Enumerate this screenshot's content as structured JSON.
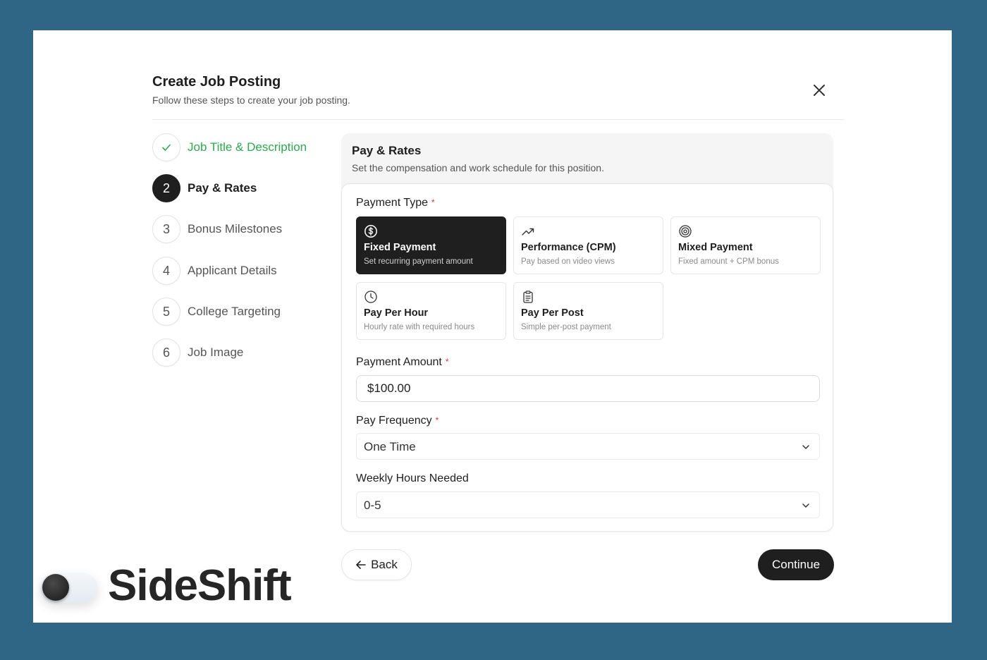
{
  "dialog": {
    "title": "Create Job Posting",
    "subtitle": "Follow these steps to create your job posting."
  },
  "steps": [
    {
      "number": "",
      "label": "Job Title & Description",
      "state": "done"
    },
    {
      "number": "2",
      "label": "Pay & Rates",
      "state": "active"
    },
    {
      "number": "3",
      "label": "Bonus Milestones",
      "state": "pending"
    },
    {
      "number": "4",
      "label": "Applicant Details",
      "state": "pending"
    },
    {
      "number": "5",
      "label": "College Targeting",
      "state": "pending"
    },
    {
      "number": "6",
      "label": "Job Image",
      "state": "pending"
    }
  ],
  "section": {
    "title": "Pay & Rates",
    "description": "Set the compensation and work schedule for this position."
  },
  "payment_type": {
    "label": "Payment Type",
    "required_mark": "*",
    "options": [
      {
        "icon": "dollar-circle-icon",
        "title": "Fixed Payment",
        "description": "Set recurring payment amount",
        "selected": true
      },
      {
        "icon": "trending-up-icon",
        "title": "Performance (CPM)",
        "description": "Pay based on video views",
        "selected": false
      },
      {
        "icon": "target-icon",
        "title": "Mixed Payment",
        "description": "Fixed amount + CPM bonus",
        "selected": false
      },
      {
        "icon": "clock-icon",
        "title": "Pay Per Hour",
        "description": "Hourly rate with required hours",
        "selected": false
      },
      {
        "icon": "clipboard-icon",
        "title": "Pay Per Post",
        "description": "Simple per-post payment",
        "selected": false
      }
    ]
  },
  "payment_amount": {
    "label": "Payment Amount",
    "required_mark": "*",
    "value": "$100.00"
  },
  "pay_frequency": {
    "label": "Pay Frequency",
    "required_mark": "*",
    "value": "One Time"
  },
  "weekly_hours": {
    "label": "Weekly Hours Needed",
    "value": "0-5"
  },
  "actions": {
    "back": "Back",
    "continue": "Continue"
  },
  "brand": {
    "name": "SideShift"
  },
  "colors": {
    "background": "#2f6686",
    "accent_dark": "#1f1f1f",
    "success_green": "#2fa84f",
    "required_red": "#e0313a"
  }
}
